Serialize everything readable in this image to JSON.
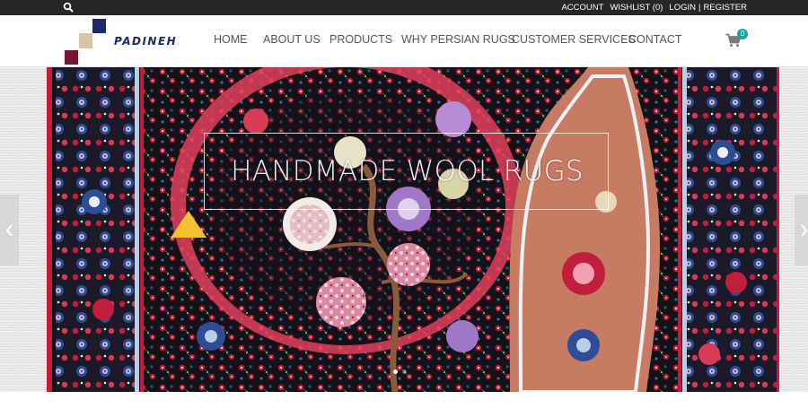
{
  "topbar": {
    "search_icon": "search-icon",
    "account": "ACCOUNT",
    "wishlist": "WISHLIST (0)",
    "login": "LOGIN",
    "separator": "|",
    "register": "REGISTER"
  },
  "header": {
    "logo_text": "PADINEH",
    "nav": [
      {
        "label": "HOME"
      },
      {
        "label": "ABOUT US"
      },
      {
        "label": "PRODUCTS"
      },
      {
        "label": "WHY PERSIAN RUGS"
      },
      {
        "label": "CUSTOMER SERVICES"
      },
      {
        "label": "CONTACT"
      }
    ],
    "cart_icon": "shopping-cart-icon",
    "cart_count": "0"
  },
  "hero": {
    "caption": "HANDMADE WOOL RUGS",
    "prev_icon": "chevron-left-icon",
    "next_icon": "chevron-right-icon",
    "slide_count": 2,
    "active_slide": 1
  },
  "colors": {
    "topbar_bg": "#262626",
    "nav_text": "#555555",
    "logo_navy": "#1b2a6b",
    "logo_beige": "#d6c4a4",
    "logo_maroon": "#7a1430",
    "badge_teal": "#19a79a",
    "rug_black": "#141217",
    "rug_red": "#c21d3a",
    "rug_pink": "#e9a0b2",
    "rug_blue": "#2d4d96",
    "rug_light_blue": "#b8cfe6",
    "rug_cream": "#f1e7d2",
    "rug_salmon": "#c77b63"
  }
}
